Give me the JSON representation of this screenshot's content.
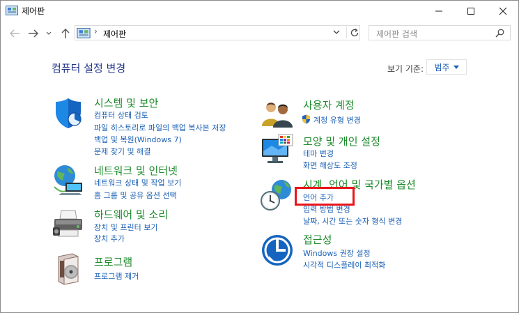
{
  "window": {
    "title": "제어판"
  },
  "address": {
    "breadcrumb": "제어판",
    "separator": "›"
  },
  "search": {
    "placeholder": "제어판 검색"
  },
  "header": {
    "title": "컴퓨터 설정 변경",
    "view_by_label": "보기 기준:",
    "view_by_value": "범주"
  },
  "categories": [
    {
      "title": "시스템 및 보안",
      "icon": "shield-icon",
      "links": [
        "컴퓨터 상태 검토",
        "파일 히스토리로 파일의 백업 복사본 저장",
        "백업 및 복원(Windows 7)",
        "문제 찾기 및 해결"
      ]
    },
    {
      "title": "네트워크 및 인터넷",
      "icon": "network-globe-icon",
      "links": [
        "네트워크 상태 및 작업 보기",
        "홈 그룹 및 공유 옵션 선택"
      ]
    },
    {
      "title": "하드웨어 및 소리",
      "icon": "printer-icon",
      "links": [
        "장치 및 프린터 보기",
        "장치 추가"
      ]
    },
    {
      "title": "프로그램",
      "icon": "program-disc-icon",
      "links": [
        "프로그램 제거"
      ]
    },
    {
      "title": "사용자 계정",
      "icon": "users-icon",
      "links": [
        "계정 유형 변경"
      ]
    },
    {
      "title": "모양 및 개인 설정",
      "icon": "monitor-icon",
      "links": [
        "테마 변경",
        "화면 해상도 조정"
      ]
    },
    {
      "title": "시계, 언어 및 국가별 옵션",
      "icon": "clock-globe-icon",
      "links": [
        "언어 추가",
        "입력 방법 변경",
        "날짜, 시간 또는 숫자 형식 변경"
      ]
    },
    {
      "title": "접근성",
      "icon": "accessibility-icon",
      "links": [
        "Windows 권장 설정",
        "시각적 디스플레이 최적화"
      ]
    }
  ],
  "colors": {
    "category_title": "#1e8b2c",
    "link": "#1a5fb4",
    "header_title": "#1e3287",
    "highlight_border": "#e8151b"
  }
}
